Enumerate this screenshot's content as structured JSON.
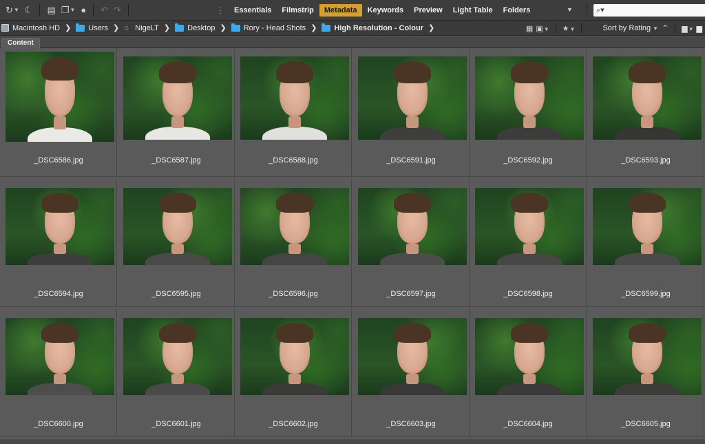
{
  "toolbar": {
    "icons": [
      "boomerang-icon",
      "moon-icon",
      "photo-downloader-icon",
      "copy-icon",
      "camera-raw-icon",
      "rotate-left-icon",
      "rotate-right-icon"
    ],
    "workspaces": [
      "Essentials",
      "Filmstrip",
      "Metadata",
      "Keywords",
      "Preview",
      "Light Table",
      "Folders"
    ],
    "active_workspace": "Metadata",
    "search_glyph": "⌕▾"
  },
  "breadcrumb": [
    {
      "label": "Macintosh HD",
      "icon": "drive-icon"
    },
    {
      "label": "Users",
      "icon": "folder-icon"
    },
    {
      "label": "NigeLT",
      "icon": "home-icon"
    },
    {
      "label": "Desktop",
      "icon": "folder-icon"
    },
    {
      "label": "Rory - Head Shots",
      "icon": "folder-icon"
    },
    {
      "label": "High Resolution - Colour",
      "icon": "folder-icon"
    }
  ],
  "sort": {
    "label": "Sort by Rating"
  },
  "panel": {
    "tab": "Content"
  },
  "files": [
    {
      "name": "_DSC6586.jpg",
      "shirt": "#e9e9e6"
    },
    {
      "name": "_DSC6587.jpg",
      "shirt": "#e6e6e3"
    },
    {
      "name": "_DSC6588.jpg",
      "shirt": "#e0e0dd"
    },
    {
      "name": "_DSC6591.jpg",
      "shirt": "#3e3f3d"
    },
    {
      "name": "_DSC6592.jpg",
      "shirt": "#3c3d3b"
    },
    {
      "name": "_DSC6593.jpg",
      "shirt": "#363735"
    },
    {
      "name": "_DSC6594.jpg",
      "shirt": "#3e3f3d"
    },
    {
      "name": "_DSC6595.jpg",
      "shirt": "#4a4b49"
    },
    {
      "name": "_DSC6596.jpg",
      "shirt": "#454644"
    },
    {
      "name": "_DSC6597.jpg",
      "shirt": "#4c4d4b"
    },
    {
      "name": "_DSC6598.jpg",
      "shirt": "#474846"
    },
    {
      "name": "_DSC6599.jpg",
      "shirt": "#4a4b49"
    },
    {
      "name": "_DSC6600.jpg",
      "shirt": "#4d4e4c"
    },
    {
      "name": "_DSC6601.jpg",
      "shirt": "#4a4b49"
    },
    {
      "name": "_DSC6602.jpg",
      "shirt": "#3a3b39"
    },
    {
      "name": "_DSC6603.jpg",
      "shirt": "#383937"
    },
    {
      "name": "_DSC6604.jpg",
      "shirt": "#3a3b39"
    },
    {
      "name": "_DSC6605.jpg",
      "shirt": "#3c3d3b"
    }
  ],
  "colors": {
    "accent": "#d4a02f",
    "folder": "#3fa8e8",
    "foliage_dark": "#1f4420",
    "foliage_light": "#3f7a2e",
    "skin": "#d8a890",
    "hair": "#4a3424"
  }
}
